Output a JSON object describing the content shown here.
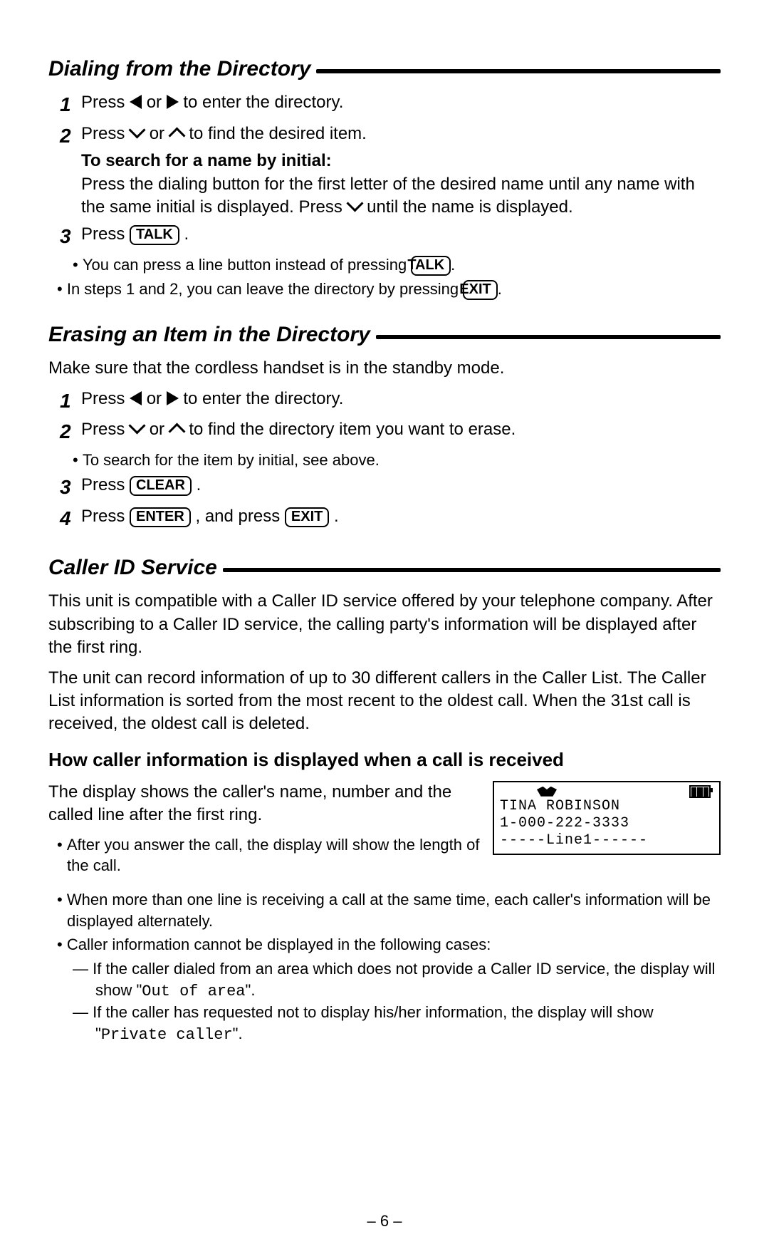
{
  "page_number": "– 6 –",
  "keys": {
    "talk": "TALK",
    "exit": "EXIT",
    "clear": "CLEAR",
    "enter": "ENTER"
  },
  "section1": {
    "title": "Dialing from the Directory",
    "step1_a": "Press ",
    "step1_b": " or ",
    "step1_c": " to enter the directory.",
    "step2_a": "Press ",
    "step2_b": " or ",
    "step2_c": " to find the desired item.",
    "search_title": "To search for a name by initial:",
    "search_body_a": "Press the dialing button for the first letter of the desired name until any name with the same initial is displayed. Press ",
    "search_body_b": " until the name is displayed.",
    "step3_a": "Press ",
    "step3_b": ".",
    "sub3_a": "You can press a line button instead of pressing ",
    "sub3_b": ".",
    "note_a": "In steps 1 and 2, you can leave the directory by pressing ",
    "note_b": "."
  },
  "section2": {
    "title": "Erasing an Item in the Directory",
    "intro": "Make sure that the cordless handset is in the standby mode.",
    "step1_a": "Press ",
    "step1_b": " or ",
    "step1_c": " to enter the directory.",
    "step2_a": "Press ",
    "step2_b": " or ",
    "step2_c": " to find the directory item you want to erase.",
    "sub2": "To search for the item by initial, see above.",
    "step3_a": "Press ",
    "step3_b": ".",
    "step4_a": "Press ",
    "step4_b": ", and press ",
    "step4_c": "."
  },
  "section3": {
    "title": "Caller ID Service",
    "para1": "This unit is compatible with a Caller ID service offered by your telephone company. After subscribing to a Caller ID service, the calling party's information will be displayed after the first ring.",
    "para2": "The unit can record information of up to 30 different callers in the Caller List. The Caller List information is sorted from the most recent to the oldest call. When the 31st call is received, the oldest call is deleted.",
    "subhead": "How caller information is displayed when a call is received",
    "display_intro": "The display shows the caller's name, number and the called line after the first ring.",
    "display_sub": "After you answer the call, the display will show the length of the call.",
    "screen": {
      "line1": "TINA ROBINSON",
      "line2": "1-000-222-3333",
      "line3": "-----Line1------"
    },
    "bullet2": "When more than one line is receiving a call at the same time, each caller's information will be displayed alternately.",
    "bullet3": "Caller information cannot be displayed in the following cases:",
    "dash1_a": "— If the caller dialed from an area which does not provide a Caller ID service, the display will show \"",
    "dash1_mono": "Out of area",
    "dash1_b": "\".",
    "dash2_a": "— If the caller has requested not to display his/her information, the display will show \"",
    "dash2_mono": "Private caller",
    "dash2_b": "\"."
  }
}
